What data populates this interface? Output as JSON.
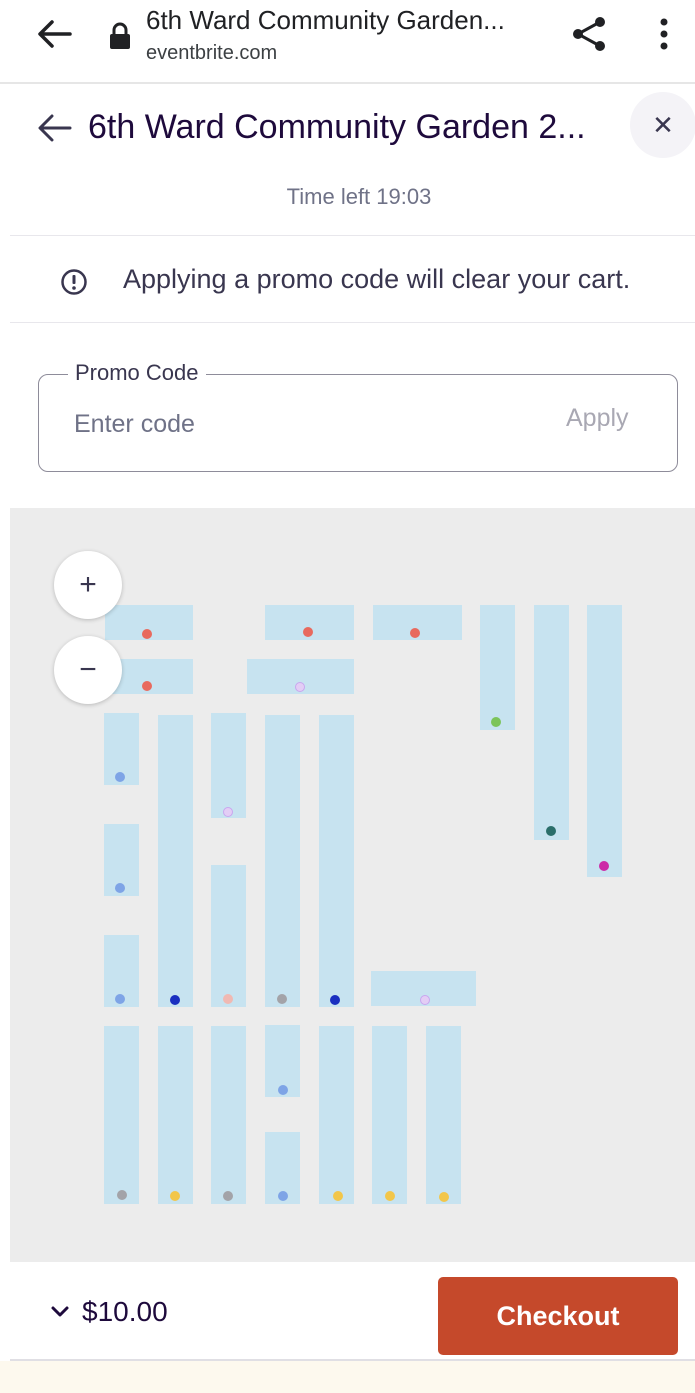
{
  "browser": {
    "title": "6th Ward Community Garden...",
    "url": "eventbrite.com",
    "icons": {
      "back": "arrow-left-icon",
      "lock": "lock-icon",
      "share": "share-icon",
      "menu": "more-vert-icon"
    }
  },
  "header": {
    "title": "6th Ward Community Garden 2...",
    "close": "✕",
    "timer": "Time left 19:03"
  },
  "notice": {
    "text": "Applying a promo code will clear your cart.",
    "icon": "alert-circle-icon"
  },
  "promo": {
    "label": "Promo Code",
    "placeholder": "Enter code",
    "value": "",
    "apply": "Apply"
  },
  "map": {
    "zoom_in": "+",
    "zoom_out": "−",
    "plot_color": "#c7e3f0",
    "background": "#ececec"
  },
  "footer": {
    "total": "$10.00",
    "checkout": "Checkout"
  },
  "colors": {
    "accent": "#c5492b",
    "text": "#1e0a3c",
    "muted": "#6f7287"
  }
}
